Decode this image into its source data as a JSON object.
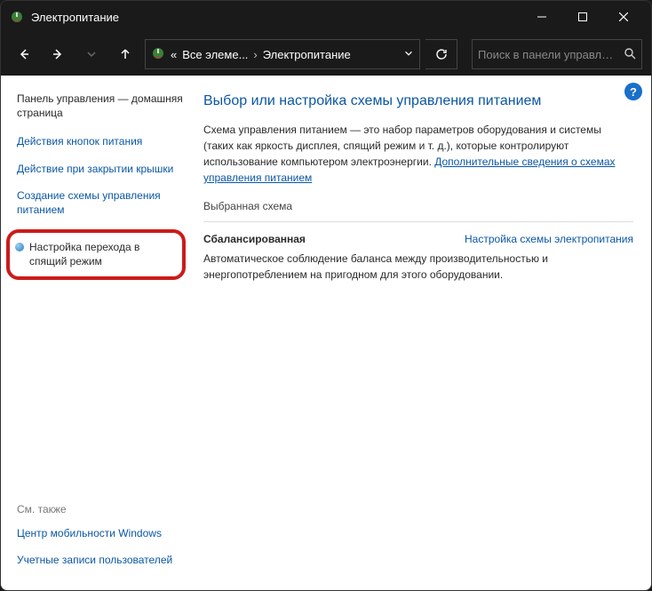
{
  "titlebar": {
    "title": "Электропитание"
  },
  "nav": {
    "crumb_prefix": "«",
    "crumb1": "Все элеме...",
    "crumb2": "Электропитание"
  },
  "search": {
    "placeholder": "Поиск в панели управлен..."
  },
  "sidebar": {
    "home": "Панель управления — домашняя страница",
    "link_buttons": "Действия кнопок питания",
    "link_lid": "Действие при закрытии крышки",
    "link_create": "Создание схемы управления питанием",
    "link_sleep": "Настройка перехода в спящий режим",
    "seealso": "См. также",
    "link_mobility": "Центр мобильности Windows",
    "link_accounts": "Учетные записи пользователей"
  },
  "main": {
    "heading": "Выбор или настройка схемы управления питанием",
    "desc1": "Схема управления питанием — это набор параметров оборудования и системы (таких как яркость дисплея, спящий режим и т. д.), которые контролируют использование компьютером электроэнергии. ",
    "desc_link": "Дополнительные сведения о схемах управления питанием",
    "section": "Выбранная схема",
    "plan_name": "Сбалансированная",
    "plan_link": "Настройка схемы электропитания",
    "plan_desc": "Автоматическое соблюдение баланса между производительностью и энергопотреблением на пригодном для этого оборудовании."
  },
  "help_glyph": "?"
}
